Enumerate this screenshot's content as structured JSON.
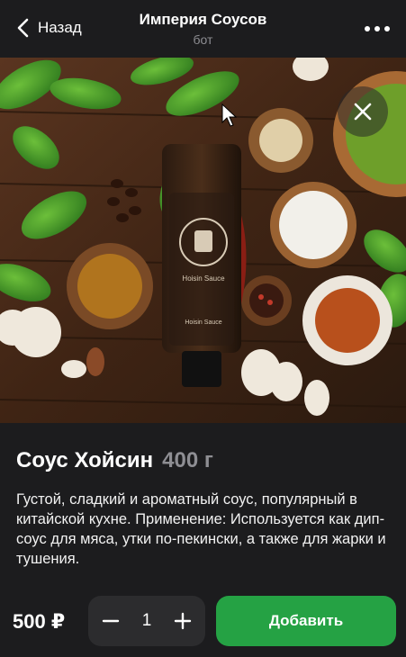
{
  "header": {
    "back_label": "Назад",
    "title": "Империя Соусов",
    "subtitle": "бот"
  },
  "hero": {
    "jar_label_brand": "Hoisin Sauce",
    "jar_label_small": "Hoisin Sauce"
  },
  "product": {
    "name": "Соус Хойсин",
    "weight": "400 г",
    "description": "Густой, сладкий и ароматный соус, популярный в китайской кухне. Применение: Используется как дип-соус для мяса, утки по-пекински, а также для жарки и тушения."
  },
  "bottom_bar": {
    "price": "500 ₽",
    "quantity": "1",
    "add_label": "Добавить"
  },
  "colors": {
    "background": "#1c1c1e",
    "accent_green": "#25a244",
    "stepper_bg": "#2c2c2e",
    "muted_text": "#8e8e93"
  },
  "icons": [
    "chevron-left-icon",
    "more-dots-icon",
    "close-icon",
    "minus-icon",
    "plus-icon"
  ]
}
